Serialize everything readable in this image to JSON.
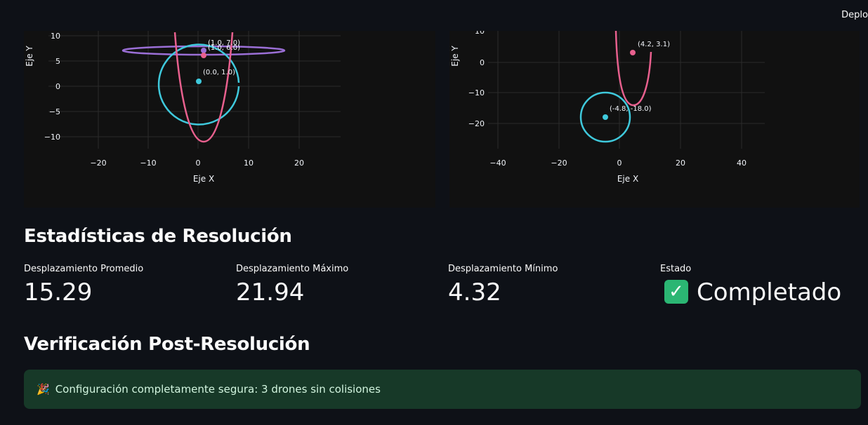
{
  "header": {
    "deploy_label": "Deplo"
  },
  "plot1": {
    "xlabel": "Eje X",
    "ylabel": "Eje Y",
    "xticks": [
      "−20",
      "−10",
      "0",
      "10",
      "20"
    ],
    "yticks": [
      "10",
      "5",
      "0",
      "−5",
      "−10"
    ],
    "points": [
      {
        "label": "(1.0, 7.0)",
        "color": "#9b6fd6"
      },
      {
        "label": "(1.0, 6.0)",
        "color": "#e8608e"
      },
      {
        "label": "(0.0, 1.0)",
        "color": "#3fc9dc"
      }
    ]
  },
  "plot2": {
    "xlabel": "Eje X",
    "ylabel": "Eje Y",
    "xticks": [
      "−40",
      "−20",
      "0",
      "20",
      "40"
    ],
    "yticks": [
      "10",
      "0",
      "−10",
      "−20"
    ],
    "points": [
      {
        "label": "(4.2, 3.1)",
        "color": "#e8608e"
      },
      {
        "label": "(-4.8, -18.0)",
        "color": "#3fc9dc"
      }
    ]
  },
  "stats": {
    "title": "Estadísticas de Resolución",
    "metrics": [
      {
        "label": "Desplazamiento Promedio",
        "value": "15.29"
      },
      {
        "label": "Desplazamiento Máximo",
        "value": "21.94"
      },
      {
        "label": "Desplazamiento Mínimo",
        "value": "4.32"
      },
      {
        "label": "Estado",
        "value": "Completado",
        "icon": "check-mark-icon"
      }
    ]
  },
  "verification": {
    "title": "Verificación Post-Resolución",
    "message": "Configuración completamente segura: 3 drones sin colisiones",
    "icon": "party-popper-icon"
  },
  "colors": {
    "background": "#0e1117",
    "plot_background": "#111111",
    "success_background": "#173928",
    "purple": "#9b6fd6",
    "pink": "#e8608e",
    "cyan": "#3fc9dc"
  }
}
